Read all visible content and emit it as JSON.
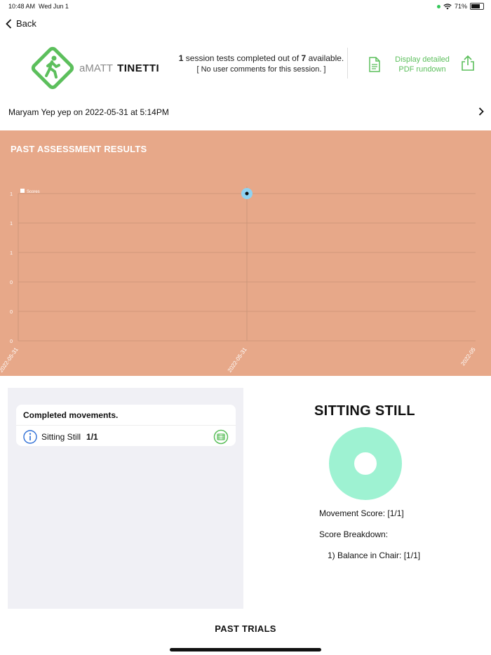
{
  "status_bar": {
    "time": "10:48 AM",
    "date": "Wed Jun 1",
    "battery": "71%"
  },
  "nav": {
    "back_label": "Back"
  },
  "header": {
    "brand_light": "aMATT",
    "brand_bold": "TINETTI",
    "completed_count": "1",
    "session_text": "session tests completed out of",
    "available_count": "7",
    "available_text": "available.",
    "comments": "[ No user comments for this session. ]",
    "pdf_label_line1": "Display detailed",
    "pdf_label_line2": "PDF rundown"
  },
  "user_row": {
    "label": "Maryam Yep yep on 2022-05-31 at 5:14PM"
  },
  "chart_section": {
    "title": "PAST ASSESSMENT RESULTS"
  },
  "chart_data": {
    "type": "scatter",
    "title": "PAST ASSESSMENT RESULTS",
    "xlabel": "",
    "ylabel": "",
    "series": [
      {
        "name": "Scores",
        "x": [
          "2022-05-31"
        ],
        "values": [
          1
        ]
      }
    ],
    "x_tick_labels": [
      "2022-05-31",
      "2022-05-31",
      "2022-05"
    ],
    "y_tick_labels": [
      "1",
      "1",
      "1",
      "0",
      "0",
      "0"
    ],
    "legend": "top-left",
    "grid": true,
    "colors": {
      "background": "#e7a889",
      "grid": "#c99579",
      "point": "#8fd3f2"
    }
  },
  "completed": {
    "title": "Completed movements.",
    "items": [
      {
        "label": "Sitting Still",
        "score": "1/1"
      }
    ]
  },
  "movement": {
    "title": "SITTING STILL",
    "movement_score": "Movement Score: [1/1]",
    "breakdown_label": "Score Breakdown:",
    "breakdown_items": [
      "1) Balance in Chair: [1/1]"
    ],
    "donut_fraction": 1,
    "colors": {
      "donut": "#9ef2d2"
    }
  },
  "past_trials": {
    "title": "PAST TRIALS"
  },
  "colors": {
    "accent_green": "#5cbf5c",
    "info_blue": "#2f6fd6"
  }
}
